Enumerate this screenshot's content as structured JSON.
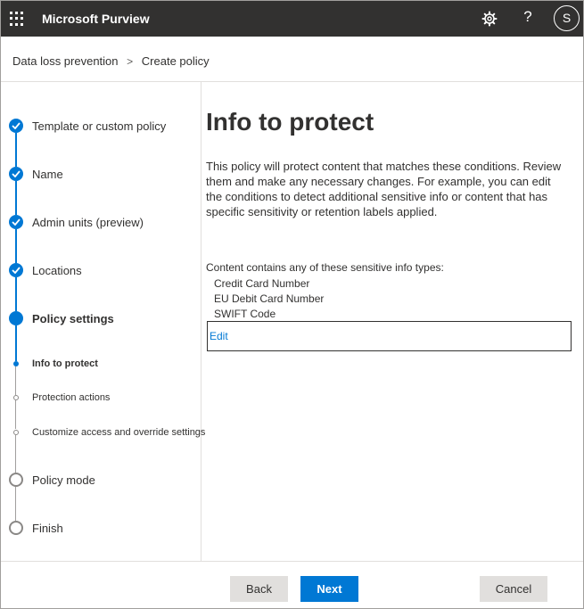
{
  "topbar": {
    "app_title": "Microsoft Purview",
    "help_glyph": "?",
    "avatar_initial": "S",
    "icons": [
      "waffle-icon",
      "gear-icon",
      "help-icon"
    ]
  },
  "breadcrumb": {
    "items": [
      "Data loss prevention",
      "Create policy"
    ],
    "separator": ">"
  },
  "steps": [
    {
      "label": "Template or custom policy",
      "state": "done"
    },
    {
      "label": "Name",
      "state": "done"
    },
    {
      "label": "Admin units (preview)",
      "state": "done"
    },
    {
      "label": "Locations",
      "state": "done"
    },
    {
      "label": "Policy settings",
      "state": "current"
    },
    {
      "label": "Info to protect",
      "state": "substep-current"
    },
    {
      "label": "Protection actions",
      "state": "substep-todo"
    },
    {
      "label": "Customize access and override settings",
      "state": "substep-todo"
    },
    {
      "label": "Policy mode",
      "state": "todo"
    },
    {
      "label": "Finish",
      "state": "todo"
    }
  ],
  "main": {
    "title": "Info to protect",
    "description": "This policy will protect content that matches these conditions. Review them and make any necessary changes. For example, you can edit the conditions to detect additional sensitive info or content that has specific sensitivity or retention labels applied.",
    "condition_label": "Content contains any of these sensitive info types:",
    "info_types": [
      "Credit Card Number",
      "EU Debit Card Number",
      "SWIFT Code"
    ],
    "edit_label": "Edit"
  },
  "footer": {
    "back_label": "Back",
    "next_label": "Next",
    "cancel_label": "Cancel"
  },
  "colors": {
    "accent": "#0078d4",
    "topbar_bg": "#323130",
    "secondary_button_bg": "#e1dfdd"
  }
}
